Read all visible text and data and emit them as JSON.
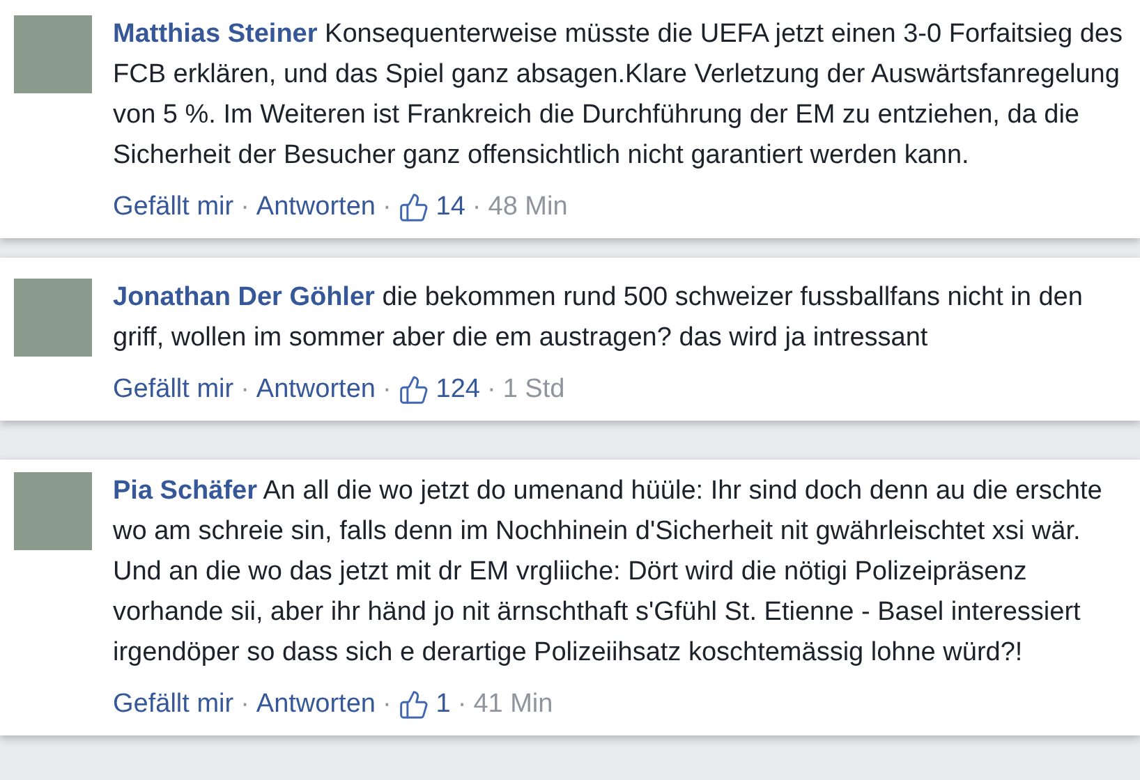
{
  "comments": [
    {
      "author": "Matthias Steiner",
      "text": "Konsequenterweise müsste die UEFA jetzt einen 3-0 Forfaitsieg des FCB erklären, und das Spiel ganz absagen.Klare Verletzung der Auswärtsfanregelung von 5 %. Im Weiteren ist Frankreich die Durchführung der EM zu entziehen, da die Sicherheit der Besucher ganz offensichtlich nicht garantiert werden kann.",
      "like_label": "Gefällt mir",
      "reply_label": "Antworten",
      "likes": "14",
      "time": "48 Min",
      "separators": [
        "·",
        "·",
        "·"
      ]
    },
    {
      "author": "Jonathan Der Göhler",
      "text": "die bekommen rund 500 schweizer fussballfans nicht in den griff, wollen im sommer aber die em austragen? das wird ja intressant",
      "like_label": "Gefällt mir",
      "reply_label": "Antworten",
      "likes": "124",
      "time": "1 Std",
      "separators": [
        "·",
        "·",
        "·"
      ]
    },
    {
      "author": "Pia Schäfer",
      "text": "An all die wo jetzt do umenand hüüle: Ihr sind doch denn au die erschte wo am schreie sin, falls denn im Nochhinein d'Sicherheit nit gwährleischtet xsi wär. Und an die wo das jetzt mit dr EM vrgliiche: Dört wird die nötigi Polizeipräsenz vorhande sii, aber ihr händ jo nit ärnschthaft s'Gfühl St. Etienne - Basel interessiert irgendöper so dass sich e derartige Polizeiihsatz koschtemässig lohne würd?!",
      "like_label": "Gefällt mir",
      "reply_label": "Antworten",
      "likes": "1",
      "time": "41 Min",
      "separators": [
        "·",
        "·",
        "·"
      ]
    }
  ]
}
